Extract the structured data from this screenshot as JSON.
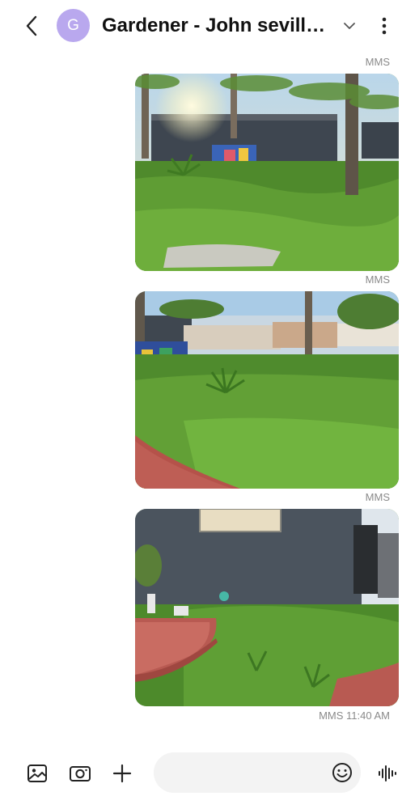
{
  "header": {
    "back_icon": "chevron-left-icon",
    "avatar_letter": "G",
    "avatar_color": "#b9a8ee",
    "title": "Gardener - John sevill…",
    "expand_icon": "chevron-down-icon",
    "more_icon": "more-vertical-icon"
  },
  "messages": [
    {
      "type": "MMS",
      "label": "MMS",
      "image": "front-yard-palms-photo"
    },
    {
      "type": "MMS",
      "label": "MMS",
      "image": "front-yard-walkway-photo"
    },
    {
      "type": "MMS",
      "label": "MMS",
      "image": "side-yard-house-wall-photo"
    }
  ],
  "last_message_time": "MMS 11:40 AM",
  "composer": {
    "gallery_icon": "gallery-icon",
    "camera_icon": "camera-icon",
    "add_icon": "plus-icon",
    "input_value": "",
    "input_placeholder": "",
    "emoji_icon": "emoji-icon",
    "voice_icon": "voice-waveform-icon"
  }
}
